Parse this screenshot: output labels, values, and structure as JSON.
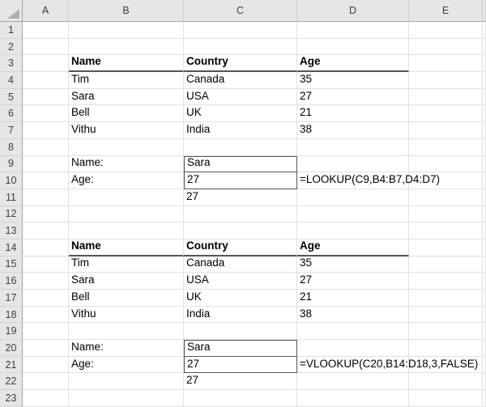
{
  "application": "spreadsheet-grid",
  "colors": {
    "header_bg": "#e6e6e6",
    "header_divider": "#d0d0d0",
    "header_edge": "#a6a6a6",
    "gridline": "#e1e1e1",
    "dark_border": "#555555",
    "cell_text": "#000000",
    "header_text": "#3f3f3f",
    "select_all_triangle": "#b0b0b0"
  },
  "sheet": {
    "columns": [
      "A",
      "B",
      "C",
      "D",
      "E"
    ],
    "visible_rows": 23,
    "cells": {
      "B3": {
        "text": "Name",
        "bold": true,
        "underline": true
      },
      "C3": {
        "text": "Country",
        "bold": true,
        "underline": true
      },
      "D3": {
        "text": "Age",
        "bold": true,
        "underline": true
      },
      "B4": {
        "text": "Tim"
      },
      "C4": {
        "text": "Canada"
      },
      "D4": {
        "text": "35"
      },
      "B5": {
        "text": "Sara"
      },
      "C5": {
        "text": "USA"
      },
      "D5": {
        "text": "27"
      },
      "B6": {
        "text": "Bell"
      },
      "C6": {
        "text": "UK"
      },
      "D6": {
        "text": "21"
      },
      "B7": {
        "text": "Vithu"
      },
      "C7": {
        "text": "India"
      },
      "D7": {
        "text": "38"
      },
      "B9": {
        "text": "Name:"
      },
      "C9": {
        "text": "Sara",
        "box": true
      },
      "B10": {
        "text": "Age:"
      },
      "C10": {
        "text": "27",
        "box": true
      },
      "D10": {
        "text": "=LOOKUP(C9,B4:B7,D4:D7)"
      },
      "C11": {
        "text": "27"
      },
      "B14": {
        "text": "Name",
        "bold": true,
        "underline": true
      },
      "C14": {
        "text": "Country",
        "bold": true,
        "underline": true
      },
      "D14": {
        "text": "Age",
        "bold": true,
        "underline": true
      },
      "B15": {
        "text": "Tim"
      },
      "C15": {
        "text": "Canada"
      },
      "D15": {
        "text": "35"
      },
      "B16": {
        "text": "Sara"
      },
      "C16": {
        "text": "USA"
      },
      "D16": {
        "text": "27"
      },
      "B17": {
        "text": "Bell"
      },
      "C17": {
        "text": "UK"
      },
      "D17": {
        "text": "21"
      },
      "B18": {
        "text": "Vithu"
      },
      "C18": {
        "text": "India"
      },
      "D18": {
        "text": "38"
      },
      "B20": {
        "text": "Name:"
      },
      "C20": {
        "text": "Sara",
        "box": true
      },
      "B21": {
        "text": "Age:"
      },
      "C21": {
        "text": "27",
        "box": true
      },
      "D21": {
        "text": "=VLOOKUP(C20,B14:D18,3,FALSE)"
      },
      "C22": {
        "text": "27"
      }
    }
  }
}
